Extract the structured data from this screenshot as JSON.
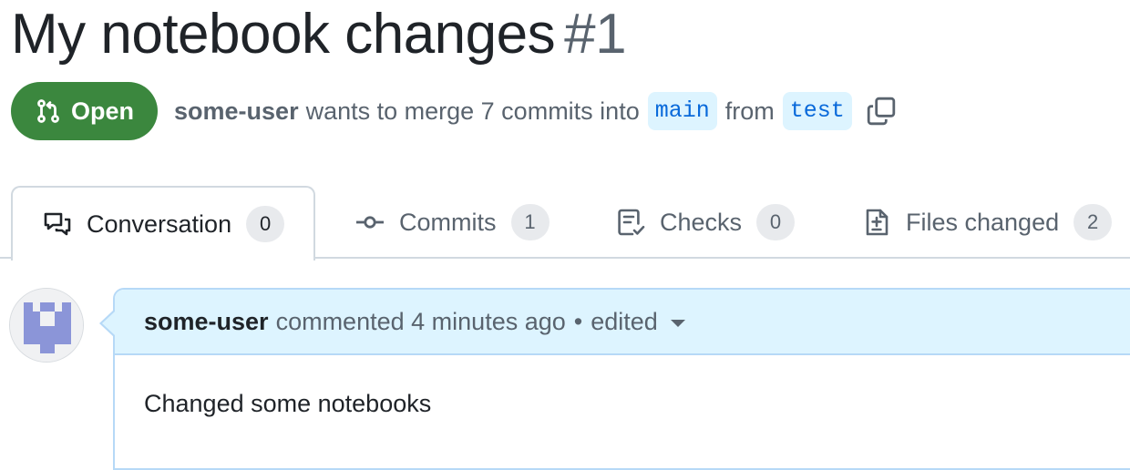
{
  "pull_request": {
    "title": "My notebook changes",
    "number": "#1",
    "state": "Open",
    "author": "some-user",
    "merge_text": "wants to merge 7 commits into",
    "base_branch": "main",
    "from_text": "from",
    "head_branch": "test"
  },
  "tabs": [
    {
      "label": "Conversation",
      "count": "0",
      "icon": "comment-discussion-icon",
      "active": true
    },
    {
      "label": "Commits",
      "count": "1",
      "icon": "git-commit-icon",
      "active": false
    },
    {
      "label": "Checks",
      "count": "0",
      "icon": "checklist-icon",
      "active": false
    },
    {
      "label": "Files changed",
      "count": "2",
      "icon": "file-diff-icon",
      "active": false
    }
  ],
  "comment": {
    "author": "some-user",
    "action": "commented",
    "time": "4 minutes ago",
    "separator": "•",
    "edited": "edited",
    "body": "Changed some notebooks"
  },
  "colors": {
    "open_state": "#3b873e",
    "branch_bg": "#ddf4ff",
    "branch_text": "#0969da",
    "comment_header_bg": "#ddf4ff",
    "comment_border": "#b6d9f7",
    "avatar": "#8b95d8"
  }
}
